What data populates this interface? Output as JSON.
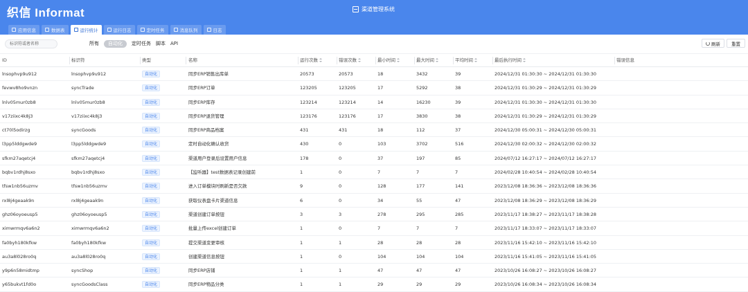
{
  "brand": "织信 Informat",
  "app_title": "渠道管理系统",
  "tabs": [
    {
      "label": "应用信息",
      "icon": "document-icon",
      "active": false
    },
    {
      "label": "数据表",
      "icon": "table-icon",
      "active": false
    },
    {
      "label": "运行统计",
      "icon": "bar-chart-icon",
      "active": true
    },
    {
      "label": "运行日志",
      "icon": "log-icon",
      "active": false
    },
    {
      "label": "定时任务",
      "icon": "clock-icon",
      "active": false
    },
    {
      "label": "消息队列",
      "icon": "queue-icon",
      "active": false
    },
    {
      "label": "日志",
      "icon": "list-icon",
      "active": false
    }
  ],
  "search": {
    "placeholder": "标识符或者名称"
  },
  "categories": [
    {
      "label": "所有",
      "active": false
    },
    {
      "label": "自动化",
      "active": true
    },
    {
      "label": "定时任务",
      "active": false
    },
    {
      "label": "脚本",
      "active": false
    },
    {
      "label": "API",
      "active": false
    }
  ],
  "buttons": {
    "refresh": "刷新",
    "reset": "重置"
  },
  "columns": [
    "ID",
    "标识符",
    "类型",
    "名称",
    "运行次数",
    "错误次数",
    "最小时间",
    "最大时间",
    "平均时间",
    "最后执行时间",
    "错误信息"
  ],
  "rows": [
    {
      "id": "lnsophvp9u912",
      "key": "lnsophvp9u912",
      "type": "自动化",
      "name": "同步ERP销售出库单",
      "runs": "20573",
      "errors": "20573",
      "min": "18",
      "max": "3432",
      "avg": "39",
      "last": "2024/12/31 01:30:30 ~ 2024/12/31 01:30:30",
      "error_info": ""
    },
    {
      "id": "fevwv8ho9vnzn",
      "key": "syncTrade",
      "type": "自动化",
      "name": "同步ERP订单",
      "runs": "123205",
      "errors": "123205",
      "min": "17",
      "max": "5292",
      "avg": "38",
      "last": "2024/12/31 01:30:29 ~ 2024/12/31 01:30:29",
      "error_info": ""
    },
    {
      "id": "lnlv05mur0zb8",
      "key": "lnlv05mur0zb8",
      "type": "自动化",
      "name": "同步ERP库存",
      "runs": "123214",
      "errors": "123214",
      "min": "14",
      "max": "16230",
      "avg": "39",
      "last": "2024/12/31 01:30:30 ~ 2024/12/31 01:30:30",
      "error_info": ""
    },
    {
      "id": "v17ziixc4k8j3",
      "key": "v17ziixc4k8j3",
      "type": "自动化",
      "name": "同步ERP退货管理",
      "runs": "123176",
      "errors": "123176",
      "min": "17",
      "max": "3830",
      "avg": "38",
      "last": "2024/12/31 01:30:29 ~ 2024/12/31 01:30:29",
      "error_info": ""
    },
    {
      "id": "ct70l5odirzg",
      "key": "syncGoods",
      "type": "自动化",
      "name": "同步ERP商品档案",
      "runs": "431",
      "errors": "431",
      "min": "18",
      "max": "112",
      "avg": "37",
      "last": "2024/12/30 05:00:31 ~ 2024/12/30 05:00:31",
      "error_info": ""
    },
    {
      "id": "l3pp5lddgwde9",
      "key": "l3pp5lddgwde9",
      "type": "自动化",
      "name": "定时自动化确认收货",
      "runs": "430",
      "errors": "0",
      "min": "103",
      "max": "3702",
      "avg": "516",
      "last": "2024/12/30 02:00:32 ~ 2024/12/30 02:00:32",
      "error_info": ""
    },
    {
      "id": "sfkm27aqetcj4",
      "key": "sfkm27aqetcj4",
      "type": "自动化",
      "name": "渠道用户登录后设置用户信息",
      "runs": "178",
      "errors": "0",
      "min": "37",
      "max": "197",
      "avg": "85",
      "last": "2024/07/12 16:27:17 ~ 2024/07/12 16:27:17",
      "error_info": ""
    },
    {
      "id": "bqbv1rdhj8sxo",
      "key": "bqbv1rdhj8sxo",
      "type": "自动化",
      "name": "【监听器】test数据表记录创建前",
      "runs": "1",
      "errors": "0",
      "min": "7",
      "max": "7",
      "avg": "7",
      "last": "2024/02/28 10:40:54 ~ 2024/02/28 10:40:54",
      "error_info": ""
    },
    {
      "id": "tfsw1nb56uzmv",
      "key": "tfsw1nb56uzmv",
      "type": "自动化",
      "name": "进入订单模块时刷新是否欠款",
      "runs": "9",
      "errors": "0",
      "min": "128",
      "max": "177",
      "avg": "141",
      "last": "2023/12/08 18:36:36 ~ 2023/12/08 18:36:36",
      "error_info": ""
    },
    {
      "id": "rxl8j4geaak9n",
      "key": "rxl8j4geaak9n",
      "type": "自动化",
      "name": "获取仪表盘卡片渠道信息",
      "runs": "6",
      "errors": "0",
      "min": "34",
      "max": "55",
      "avg": "47",
      "last": "2023/12/08 18:36:29 ~ 2023/12/08 18:36:29",
      "error_info": ""
    },
    {
      "id": "ghz06oyoeusp5",
      "key": "ghz06oyoeusp5",
      "type": "自动化",
      "name": "渠道创建订单按钮",
      "runs": "3",
      "errors": "3",
      "min": "278",
      "max": "295",
      "avg": "285",
      "last": "2023/11/17 18:38:27 ~ 2023/11/17 18:38:28",
      "error_info": ""
    },
    {
      "id": "ximwrmqv6a6n2",
      "key": "ximwrmqv6a6n2",
      "type": "自动化",
      "name": "批量上传excel创建订单",
      "runs": "1",
      "errors": "0",
      "min": "7",
      "max": "7",
      "avg": "7",
      "last": "2023/11/17 18:33:07 ~ 2023/11/17 18:33:07",
      "error_info": ""
    },
    {
      "id": "fa0byh180kfkw",
      "key": "fa0byh180kfkw",
      "type": "自动化",
      "name": "提交渠道变更审核",
      "runs": "1",
      "errors": "1",
      "min": "28",
      "max": "28",
      "avg": "28",
      "last": "2023/11/16 15:42:10 ~ 2023/11/16 15:42:10",
      "error_info": ""
    },
    {
      "id": "au3a8l028ro0q",
      "key": "au3a8l028ro0q",
      "type": "自动化",
      "name": "创建渠道信息按钮",
      "runs": "1",
      "errors": "0",
      "min": "104",
      "max": "104",
      "avg": "104",
      "last": "2023/11/16 15:41:05 ~ 2023/11/16 15:41:05",
      "error_info": ""
    },
    {
      "id": "y9p6n58midtmp",
      "key": "syncShop",
      "type": "自动化",
      "name": "同步ERP店铺",
      "runs": "1",
      "errors": "1",
      "min": "47",
      "max": "47",
      "avg": "47",
      "last": "2023/10/26 16:08:27 ~ 2023/10/26 16:08:27",
      "error_info": ""
    },
    {
      "id": "y65bukvt1fd0o",
      "key": "syncGoodsClass",
      "type": "自动化",
      "name": "同步ERP物品分类",
      "runs": "1",
      "errors": "1",
      "min": "29",
      "max": "29",
      "avg": "29",
      "last": "2023/10/26 16:08:34 ~ 2023/10/26 16:08:34",
      "error_info": ""
    }
  ]
}
